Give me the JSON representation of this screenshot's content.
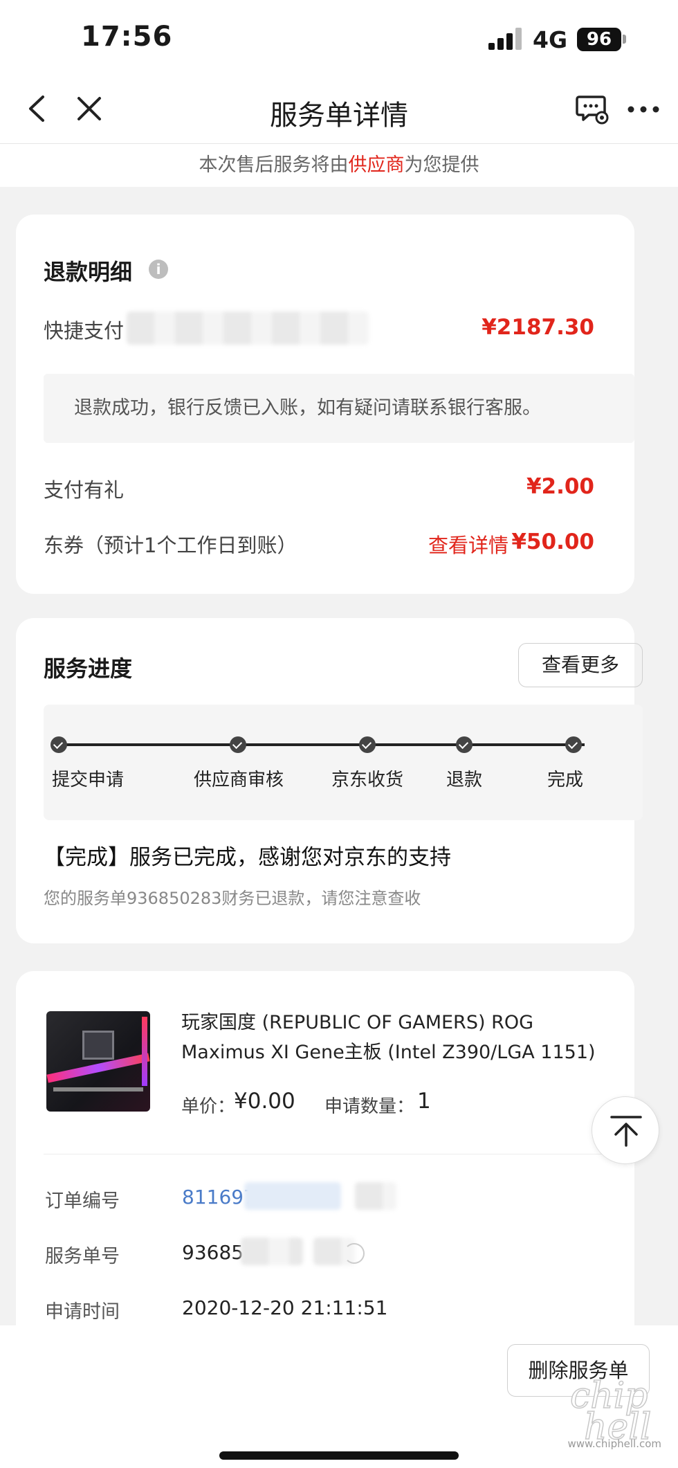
{
  "status_bar": {
    "time": "17:56",
    "network": "4G",
    "battery": "96"
  },
  "nav": {
    "title": "服务单详情"
  },
  "notice": {
    "prefix": "本次售后服务将由",
    "highlight": "供应商",
    "suffix": "为您提供"
  },
  "refund": {
    "title": "退款明细",
    "method_label": "快捷支付",
    "method_amount": "¥2187.30",
    "tip": "退款成功，银行反馈已入账，如有疑问请联系银行客服。",
    "gift_label": "支付有礼",
    "gift_amount": "¥2.00",
    "coupon_label": "东券（预计1个工作日到账）",
    "coupon_link": "查看详情",
    "coupon_amount": "¥50.00"
  },
  "progress": {
    "title": "服务进度",
    "more_label": "查看更多",
    "steps": [
      "提交申请",
      "供应商审核",
      "京东收货",
      "退款",
      "完成"
    ],
    "status_head": "【完成】服务已完成，感谢您对京东的支持",
    "status_sub": "您的服务单936850283财务已退款，请您注意查收"
  },
  "product": {
    "name_line1": "玩家国度 (REPUBLIC OF GAMERS) ROG",
    "name_line2": "Maximus XI Gene主板 (Intel Z390/LGA 1151)",
    "price_label": "单价：",
    "price": "¥0.00",
    "qty_label": "申请数量：",
    "qty": "1"
  },
  "order_info": {
    "order_no_label": "订单编号",
    "order_no": "811697",
    "service_no_label": "服务单号",
    "service_no": "93685",
    "apply_time_label": "申请时间",
    "apply_time": "2020-12-20 21:11:51"
  },
  "bottom": {
    "delete_label": "删除服务单"
  },
  "watermark": {
    "url": "www.chiphell.com"
  },
  "colors": {
    "accent_red": "#e1251b",
    "link_blue": "#4a7bc8"
  }
}
